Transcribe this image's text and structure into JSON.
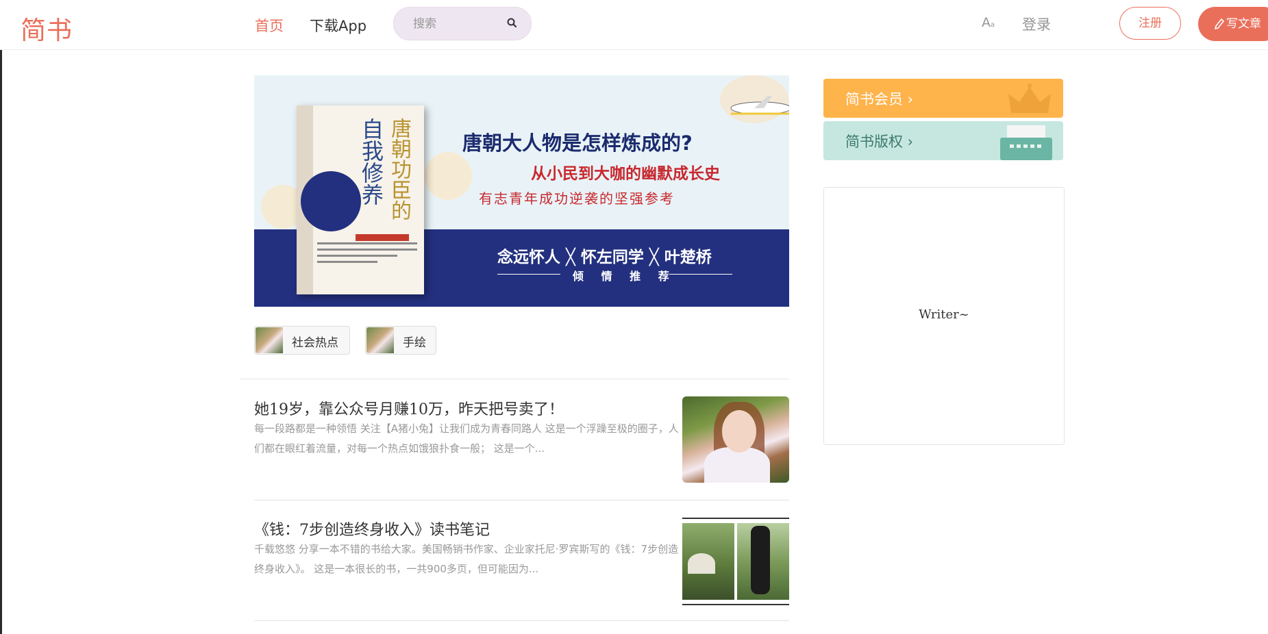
{
  "header": {
    "logo": "简书",
    "nav": {
      "home": "首页",
      "download_app": "下载App"
    },
    "search": {
      "placeholder": "搜索"
    },
    "font_toggle": "A",
    "font_toggle_sub": "a",
    "login": "登录",
    "register": "注册",
    "write": "写文章"
  },
  "banner": {
    "headline": "唐朝大人物是怎样炼成的?",
    "subline": "从小民到大咖的幽默成长史",
    "tagline": "有志青年成功逆袭的坚强参考",
    "authors": "念远怀人 ╳ 怀左同学 ╳ 叶楚桥",
    "recommend": "倾 情 推 荐",
    "book_title": "自我修养",
    "book_title2": "唐朝功臣的"
  },
  "tags": [
    {
      "label": "社会热点"
    },
    {
      "label": "手绘"
    }
  ],
  "articles": [
    {
      "title": "她19岁，靠公众号月赚10万，昨天把号卖了！",
      "abstract": "每一段路都是一种领悟 关注【A猪小兔】让我们成为青春同路人 这是一个浮躁至极的圈子，人们都在眼红着流量，对每一个热点如饿狼扑食一般； 这是一个..."
    },
    {
      "title": "《钱：7步创造终身收入》读书笔记",
      "abstract": "千载悠悠 分享一本不错的书给大家。美国畅销书作家、企业家托尼·罗宾斯写的《钱：7步创造终身收入》。 这是一本很长的书，一共900多页，但可能因为..."
    }
  ],
  "sidebar": {
    "member": "简书会员 ›",
    "copyright": "简书版权 ›",
    "writer_box": "Writer~"
  },
  "colors": {
    "brand": "#ea6f5a",
    "member": "#ffb34b",
    "copyright": "#c6e7df",
    "banner_navy": "#23307f"
  }
}
